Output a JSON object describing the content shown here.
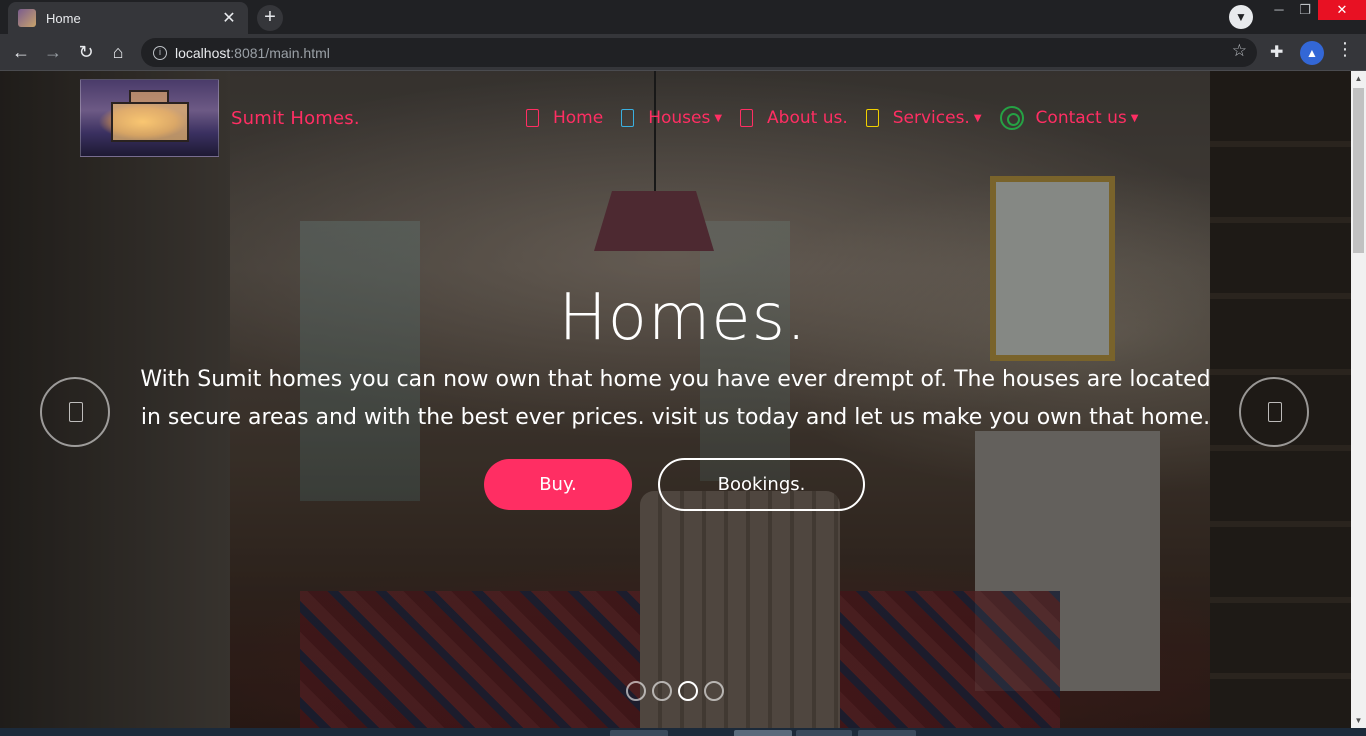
{
  "browser": {
    "tab_title": "Home",
    "tab_close": "✕",
    "new_tab": "+",
    "url_host": "localhost",
    "url_rest": ":8081/main.html",
    "window_min": "─",
    "window_max": "❐",
    "window_close": "✕"
  },
  "site": {
    "brand_name": "Sumit Homes.",
    "nav": [
      {
        "label": "Home",
        "icon": "home-icon",
        "dropdown": false
      },
      {
        "label": "Houses",
        "icon": "houses-icon",
        "dropdown": true
      },
      {
        "label": "About us.",
        "icon": "about-icon",
        "dropdown": false
      },
      {
        "label": "Services.",
        "icon": "services-icon",
        "dropdown": true
      },
      {
        "label": "Contact us",
        "icon": "whatsapp-icon",
        "dropdown": true
      }
    ],
    "caret": "▼"
  },
  "hero": {
    "title": "Homes.",
    "text": "With Sumit homes you can now own that home you have ever drempt of. The houses are located in secure areas and with the best ever prices. visit us today and let us make you own that home.",
    "buy_label": "Buy.",
    "bookings_label": "Bookings.",
    "slide_count": 4,
    "active_slide": 3
  },
  "colors": {
    "accent": "#ff2e63",
    "whatsapp": "#25a244",
    "houses_icon": "#3ab0e0",
    "services_icon": "#f0d000"
  }
}
